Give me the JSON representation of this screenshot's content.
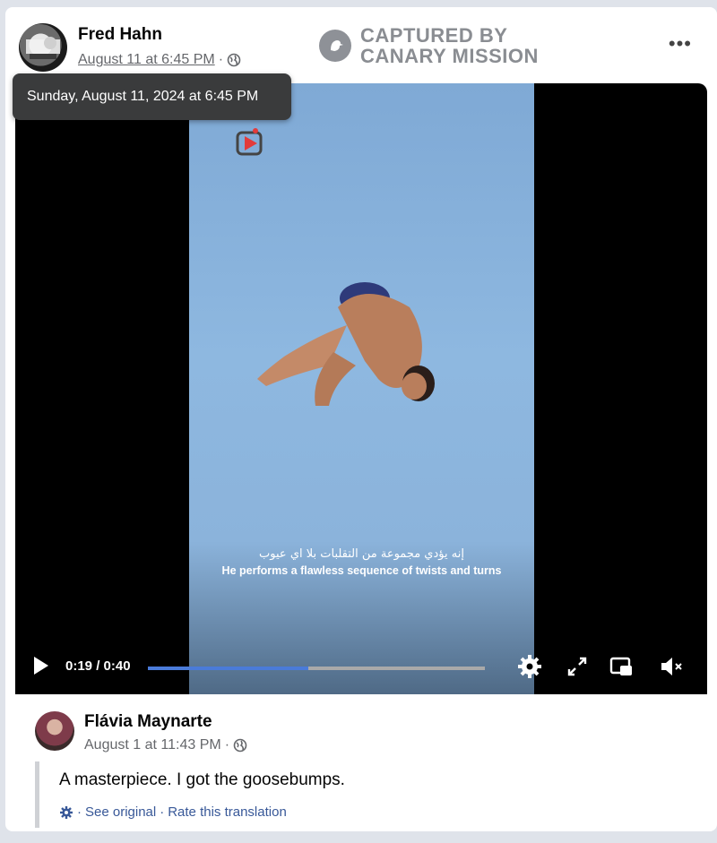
{
  "post": {
    "author": "Fred Hahn",
    "date": "August 11 at 6:45 PM",
    "separator": "·",
    "more_label": "•••"
  },
  "watermark": {
    "line1": "CAPTURED BY",
    "line2": "CANARY MISSION"
  },
  "tooltip": {
    "text": "Sunday, August 11, 2024 at 6:45 PM"
  },
  "video": {
    "caption_arabic": "إنه يؤدي مجموعة من التقلبات بلا اي عيوب",
    "caption_english": "He performs a flawless sequence of twists and turns",
    "time": "0:19 / 0:40",
    "progress": 0.475
  },
  "comment": {
    "author": "Flávia Maynarte",
    "date": "August 1 at 11:43 PM",
    "separator": "·",
    "text": "A masterpiece. I got the goosebumps.",
    "see_original": "See original",
    "dot": "·",
    "rate_translation": "Rate this translation"
  },
  "colors": {
    "link": "#385898",
    "progress": "#4a7bd9",
    "tooltip_bg": "#3a3b3c"
  }
}
